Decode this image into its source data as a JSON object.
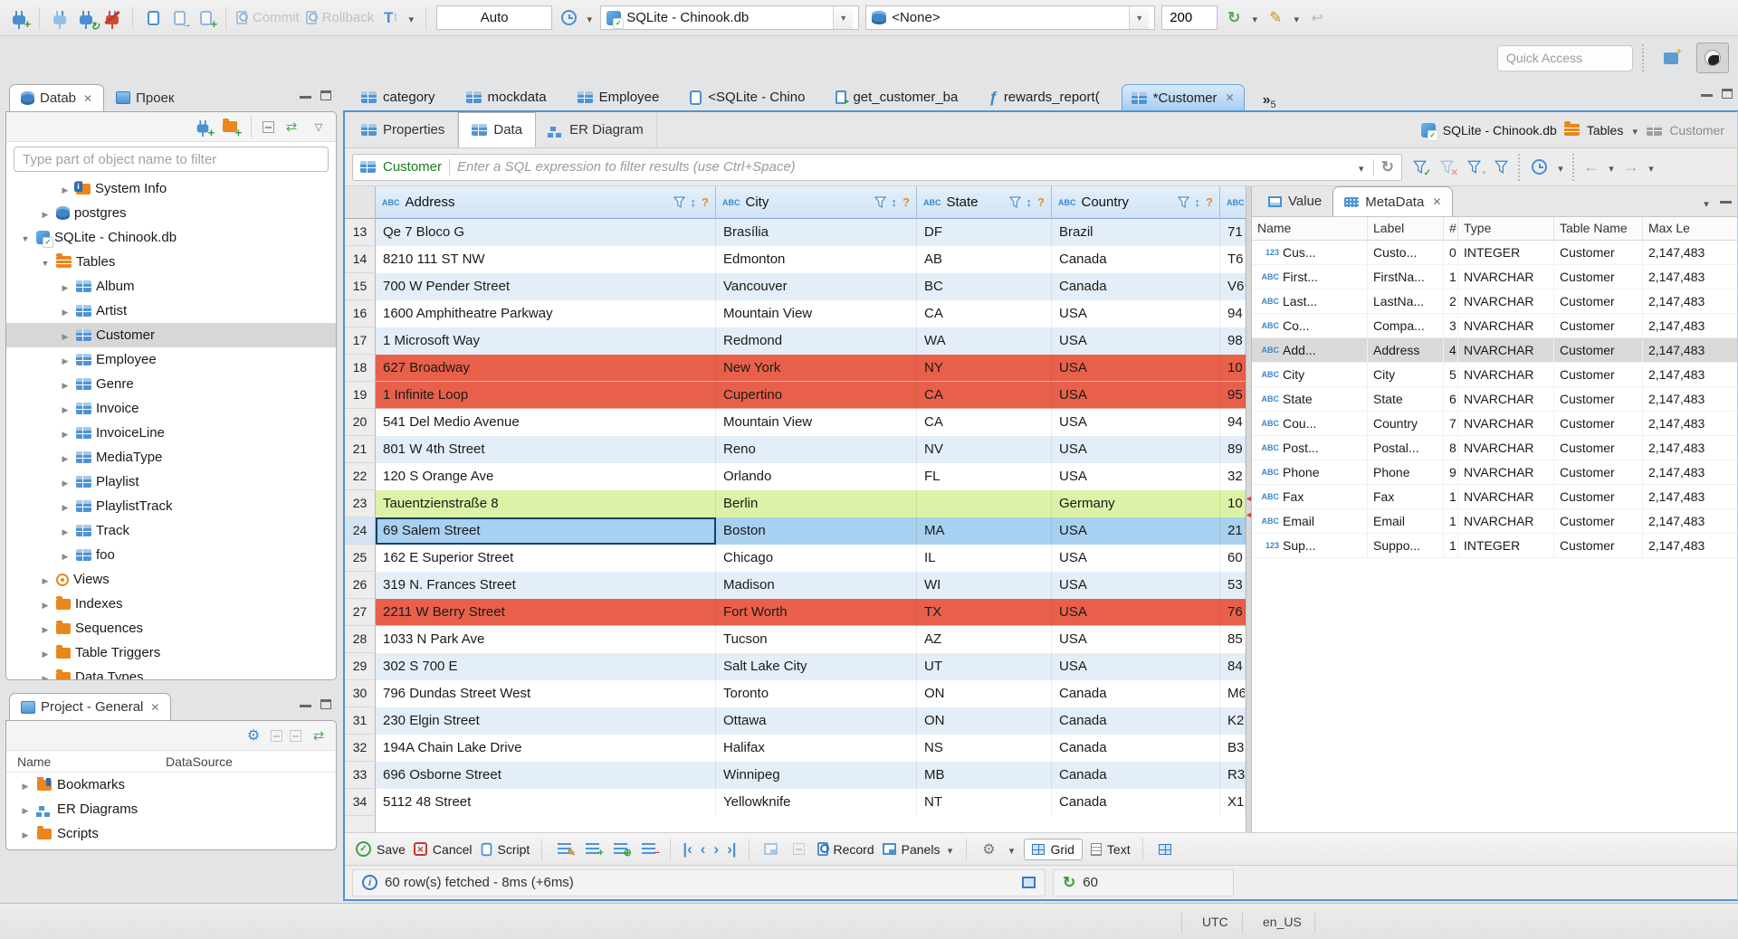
{
  "toolbar": {
    "commit": "Commit",
    "rollback": "Rollback",
    "auto": "Auto",
    "datasource": "SQLite - Chinook.db",
    "schema": "<None>",
    "fetchsize": "200",
    "quickaccess": "Quick Access"
  },
  "left": {
    "tabs": [
      {
        "label": "Datab",
        "icon": "ti-db",
        "cls": "active",
        "closecls": "show"
      },
      {
        "label": "Проек",
        "icon": "projtab"
      }
    ],
    "filter_placeholder": "Type part of object name to filter",
    "tree": [
      {
        "cls": "ind2",
        "arrow": "r",
        "icon": "ti-info",
        "label": "System Info"
      },
      {
        "cls": "ind1",
        "arrow": "r",
        "icon": "ti-db",
        "label": "postgres"
      },
      {
        "cls": "ind0",
        "arrow": "d",
        "icon": "ti-sqlite",
        "label": "SQLite - Chinook.db"
      },
      {
        "cls": "ind1",
        "arrow": "d",
        "icon": "ti-tables",
        "label": "Tables"
      },
      {
        "cls": "ind2",
        "arrow": "r",
        "icon": "ti-table",
        "label": "Album"
      },
      {
        "cls": "ind2",
        "arrow": "r",
        "icon": "ti-table",
        "label": "Artist"
      },
      {
        "cls": "ind2 sel",
        "arrow": "r",
        "icon": "ti-table",
        "label": "Customer"
      },
      {
        "cls": "ind2",
        "arrow": "r",
        "icon": "ti-table",
        "label": "Employee"
      },
      {
        "cls": "ind2",
        "arrow": "r",
        "icon": "ti-table",
        "label": "Genre"
      },
      {
        "cls": "ind2",
        "arrow": "r",
        "icon": "ti-table",
        "label": "Invoice"
      },
      {
        "cls": "ind2",
        "arrow": "r",
        "icon": "ti-table",
        "label": "InvoiceLine"
      },
      {
        "cls": "ind2",
        "arrow": "r",
        "icon": "ti-table",
        "label": "MediaType"
      },
      {
        "cls": "ind2",
        "arrow": "r",
        "icon": "ti-table",
        "label": "Playlist"
      },
      {
        "cls": "ind2",
        "arrow": "r",
        "icon": "ti-table",
        "label": "PlaylistTrack"
      },
      {
        "cls": "ind2",
        "arrow": "r",
        "icon": "ti-table",
        "label": "Track"
      },
      {
        "cls": "ind2",
        "arrow": "r",
        "icon": "ti-table",
        "label": "foo"
      },
      {
        "cls": "ind1",
        "arrow": "r",
        "icon": "ti-views",
        "label": "Views"
      },
      {
        "cls": "ind1",
        "arrow": "r",
        "icon": "ti-folder",
        "label": "Indexes"
      },
      {
        "cls": "ind1",
        "arrow": "r",
        "icon": "ti-folder",
        "label": "Sequences"
      },
      {
        "cls": "ind1",
        "arrow": "r",
        "icon": "ti-folder",
        "label": "Table Triggers"
      },
      {
        "cls": "ind1",
        "arrow": "r",
        "icon": "ti-folder",
        "label": "Data Types"
      }
    ],
    "project": {
      "tab": "Project - General",
      "cols": {
        "name": "Name",
        "datasource": "DataSource"
      },
      "rows": [
        {
          "icon": "ti-bm",
          "label": "Bookmarks"
        },
        {
          "icon": "ti-erd",
          "label": "ER Diagrams"
        },
        {
          "icon": "ti-folder",
          "label": "Scripts"
        }
      ]
    }
  },
  "editor": {
    "tabs": [
      {
        "icon": "i-table",
        "label": "category"
      },
      {
        "icon": "i-table",
        "label": "mockdata"
      },
      {
        "icon": "i-table",
        "label": "Employee"
      },
      {
        "icon": "i-sql",
        "label": "<SQLite - Chino"
      },
      {
        "icon": "i-sqlrun",
        "label": "get_customer_ba"
      },
      {
        "icon": "i-func",
        "label": "rewards_report("
      },
      {
        "icon": "i-table",
        "label": "*Customer",
        "cls": "active",
        "closecls": "show"
      }
    ],
    "overflow": {
      "glyph": "»",
      "count": "5"
    },
    "subtabs": [
      {
        "icon": "i-table",
        "label": "Properties"
      },
      {
        "icon": "i-table",
        "label": "Data",
        "cls": "active"
      },
      {
        "icon": "ti-erd",
        "label": "ER Diagram"
      }
    ],
    "breadcrumb": {
      "db": "SQLite - Chinook.db",
      "tables": "Tables",
      "table": "Customer"
    },
    "filter": {
      "table": "Customer",
      "placeholder": "Enter a SQL expression to filter results (use Ctrl+Space)"
    }
  },
  "grid": {
    "cols": [
      {
        "label": "Address"
      },
      {
        "label": "City"
      },
      {
        "label": "State"
      },
      {
        "label": "Country"
      }
    ],
    "rows": [
      {
        "num": "13",
        "address": "Qe 7 Bloco G",
        "city": "Brasília",
        "state": "DF",
        "country": "Brazil",
        "postal": "71",
        "cls": "alt"
      },
      {
        "num": "14",
        "address": "8210 111 ST NW",
        "city": "Edmonton",
        "state": "AB",
        "country": "Canada",
        "postal": "T6",
        "cls": "plain"
      },
      {
        "num": "15",
        "address": "700 W Pender Street",
        "city": "Vancouver",
        "state": "BC",
        "country": "Canada",
        "postal": "V6",
        "cls": "alt"
      },
      {
        "num": "16",
        "address": "1600 Amphitheatre Parkway",
        "city": "Mountain View",
        "state": "CA",
        "country": "USA",
        "postal": "94",
        "cls": "plain"
      },
      {
        "num": "17",
        "address": "1 Microsoft Way",
        "city": "Redmond",
        "state": "WA",
        "country": "USA",
        "postal": "98",
        "cls": "alt"
      },
      {
        "num": "18",
        "address": "627 Broadway",
        "city": "New York",
        "state": "NY",
        "country": "USA",
        "postal": "10",
        "cls": "red"
      },
      {
        "num": "19",
        "address": "1 Infinite Loop",
        "city": "Cupertino",
        "state": "CA",
        "country": "USA",
        "postal": "95",
        "cls": "red"
      },
      {
        "num": "20",
        "address": "541 Del Medio Avenue",
        "city": "Mountain View",
        "state": "CA",
        "country": "USA",
        "postal": "94",
        "cls": "plain"
      },
      {
        "num": "21",
        "address": "801 W 4th Street",
        "city": "Reno",
        "state": "NV",
        "country": "USA",
        "postal": "89",
        "cls": "alt"
      },
      {
        "num": "22",
        "address": "120 S Orange Ave",
        "city": "Orlando",
        "state": "FL",
        "country": "USA",
        "postal": "32",
        "cls": "plain"
      },
      {
        "num": "23",
        "address": "Tauentzienstraße 8",
        "city": "Berlin",
        "state": "",
        "country": "Germany",
        "postal": "10",
        "cls": "green"
      },
      {
        "num": "24",
        "address": "69 Salem Street",
        "city": "Boston",
        "state": "MA",
        "country": "USA",
        "postal": "21",
        "cls": "selrow",
        "ac": "focus"
      },
      {
        "num": "25",
        "address": "162 E Superior Street",
        "city": "Chicago",
        "state": "IL",
        "country": "USA",
        "postal": "60",
        "cls": "plain"
      },
      {
        "num": "26",
        "address": "319 N. Frances Street",
        "city": "Madison",
        "state": "WI",
        "country": "USA",
        "postal": "53",
        "cls": "alt"
      },
      {
        "num": "27",
        "address": "2211 W Berry Street",
        "city": "Fort Worth",
        "state": "TX",
        "country": "USA",
        "postal": "76",
        "cls": "red"
      },
      {
        "num": "28",
        "address": "1033 N Park Ave",
        "city": "Tucson",
        "state": "AZ",
        "country": "USA",
        "postal": "85",
        "cls": "plain"
      },
      {
        "num": "29",
        "address": "302 S 700 E",
        "city": "Salt Lake City",
        "state": "UT",
        "country": "USA",
        "postal": "84",
        "cls": "alt"
      },
      {
        "num": "30",
        "address": "796 Dundas Street West",
        "city": "Toronto",
        "state": "ON",
        "country": "Canada",
        "postal": "M6",
        "cls": "plain"
      },
      {
        "num": "31",
        "address": "230 Elgin Street",
        "city": "Ottawa",
        "state": "ON",
        "country": "Canada",
        "postal": "K2",
        "cls": "alt"
      },
      {
        "num": "32",
        "address": "194A Chain Lake Drive",
        "city": "Halifax",
        "state": "NS",
        "country": "Canada",
        "postal": "B3",
        "cls": "plain"
      },
      {
        "num": "33",
        "address": "696 Osborne Street",
        "city": "Winnipeg",
        "state": "MB",
        "country": "Canada",
        "postal": "R3",
        "cls": "alt"
      },
      {
        "num": "34",
        "address": "5112 48 Street",
        "city": "Yellowknife",
        "state": "NT",
        "country": "Canada",
        "postal": "X1",
        "cls": "plain"
      }
    ]
  },
  "meta": {
    "tabs": [
      {
        "icon": "i-value",
        "label": "Value"
      },
      {
        "icon": "i-keyb",
        "label": "MetaData",
        "cls": "active",
        "closecls": "show"
      }
    ],
    "cols": {
      "name": "Name",
      "label": "Label",
      "num": "#",
      "type": "Type",
      "table": "Table Name",
      "max": "Max Le"
    },
    "rows": [
      {
        "icon": "123",
        "name": "Cus...",
        "label": "Custo...",
        "num": "0",
        "type": "INTEGER",
        "table": "Customer",
        "max": "2,147,483"
      },
      {
        "icon": "ABC",
        "name": "First...",
        "label": "FirstNa...",
        "num": "1",
        "type": "NVARCHAR",
        "table": "Customer",
        "max": "2,147,483"
      },
      {
        "icon": "ABC",
        "name": "Last...",
        "label": "LastNa...",
        "num": "2",
        "type": "NVARCHAR",
        "table": "Customer",
        "max": "2,147,483"
      },
      {
        "icon": "ABC",
        "name": "Co...",
        "label": "Compa...",
        "num": "3",
        "type": "NVARCHAR",
        "table": "Customer",
        "max": "2,147,483"
      },
      {
        "icon": "ABC",
        "name": "Add...",
        "label": "Address",
        "num": "4",
        "type": "NVARCHAR",
        "table": "Customer",
        "max": "2,147,483",
        "cls": "sel"
      },
      {
        "icon": "ABC",
        "name": "City",
        "label": "City",
        "num": "5",
        "type": "NVARCHAR",
        "table": "Customer",
        "max": "2,147,483"
      },
      {
        "icon": "ABC",
        "name": "State",
        "label": "State",
        "num": "6",
        "type": "NVARCHAR",
        "table": "Customer",
        "max": "2,147,483"
      },
      {
        "icon": "ABC",
        "name": "Cou...",
        "label": "Country",
        "num": "7",
        "type": "NVARCHAR",
        "table": "Customer",
        "max": "2,147,483"
      },
      {
        "icon": "ABC",
        "name": "Post...",
        "label": "Postal...",
        "num": "8",
        "type": "NVARCHAR",
        "table": "Customer",
        "max": "2,147,483"
      },
      {
        "icon": "ABC",
        "name": "Phone",
        "label": "Phone",
        "num": "9",
        "type": "NVARCHAR",
        "table": "Customer",
        "max": "2,147,483"
      },
      {
        "icon": "ABC",
        "name": "Fax",
        "label": "Fax",
        "num": "1",
        "type": "NVARCHAR",
        "table": "Customer",
        "max": "2,147,483"
      },
      {
        "icon": "ABC",
        "name": "Email",
        "label": "Email",
        "num": "1",
        "type": "NVARCHAR",
        "table": "Customer",
        "max": "2,147,483"
      },
      {
        "icon": "123",
        "name": "Sup...",
        "label": "Suppo...",
        "num": "1",
        "type": "INTEGER",
        "table": "Customer",
        "max": "2,147,483"
      }
    ]
  },
  "bottombar": {
    "save": "Save",
    "cancel": "Cancel",
    "script": "Script",
    "record": "Record",
    "panels": "Panels",
    "grid": "Grid",
    "text": "Text"
  },
  "status": {
    "fetch": "60 row(s) fetched - 8ms (+6ms)",
    "count": "60"
  },
  "winstatus": {
    "tz": "UTC",
    "locale": "en_US"
  }
}
